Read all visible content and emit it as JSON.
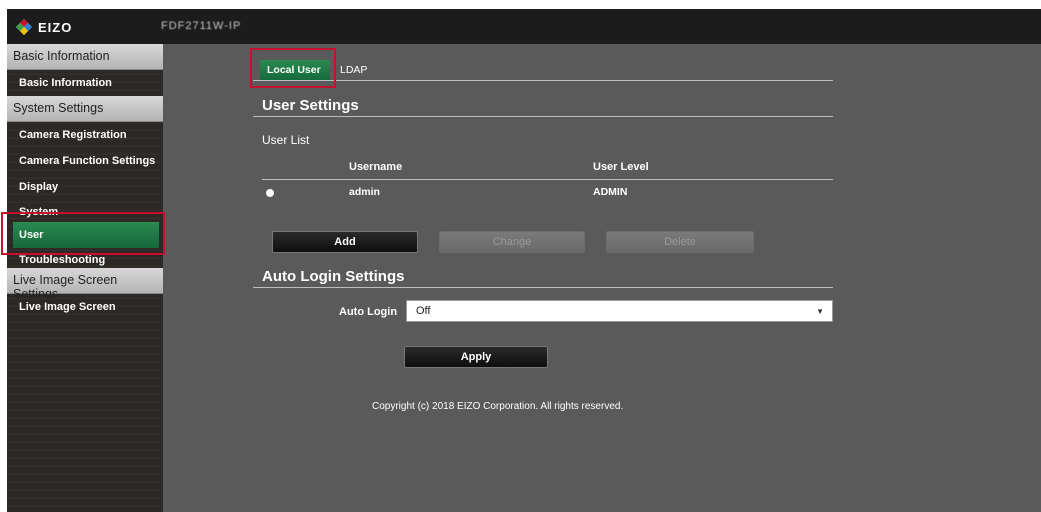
{
  "header": {
    "brand": "EIZO",
    "device_name": "FDF2711W-IP"
  },
  "sidebar": {
    "sections": [
      {
        "title": "Basic Information",
        "items": [
          "Basic Information"
        ]
      },
      {
        "title": "System Settings",
        "items": [
          "Camera Registration",
          "Camera Function Settings",
          "Display",
          "System",
          "User",
          "Troubleshooting"
        ]
      },
      {
        "title": "Live Image Screen Settings",
        "items": [
          "Live Image Screen"
        ]
      }
    ],
    "active_item": "User"
  },
  "tabs": {
    "local_user": "Local User",
    "ldap": "LDAP"
  },
  "user_settings": {
    "heading": "User Settings",
    "list_label": "User List",
    "columns": [
      "Username",
      "User Level"
    ],
    "rows": [
      {
        "username": "admin",
        "level": "ADMIN",
        "selected": true
      }
    ],
    "buttons": {
      "add": "Add",
      "change": "Change",
      "delete": "Delete"
    }
  },
  "auto_login": {
    "heading": "Auto Login Settings",
    "label": "Auto Login",
    "value": "Off",
    "apply": "Apply"
  },
  "footer": {
    "copyright": "Copyright (c) 2018 EIZO Corporation. All rights reserved."
  },
  "colors": {
    "accent_green": "#15683a",
    "highlight_red": "#c8102e",
    "background": "#5a5a5a"
  }
}
